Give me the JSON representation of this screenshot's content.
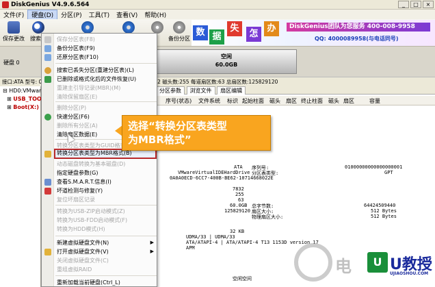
{
  "window": {
    "title": "DiskGenius V4.9.6.564",
    "buttons": [
      "_",
      "□",
      "×"
    ]
  },
  "menubar": [
    "文件(F)",
    "硬盘(D)",
    "分区(P)",
    "工具(T)",
    "查看(V)",
    "帮助(H)"
  ],
  "toolbar": [
    {
      "label": "保存更改",
      "icon": "save-icon"
    },
    {
      "label": "搜索分",
      "icon": "search-icon"
    },
    {
      "label": "",
      "icon": "disk-icon"
    },
    {
      "label": "",
      "icon": "disk-icon"
    },
    {
      "label": "",
      "icon": "disk-icon"
    },
    {
      "label": "备份分区",
      "icon": "disk-icon"
    }
  ],
  "banner": {
    "chars": [
      "数",
      "据",
      "失",
      "怎",
      "办"
    ],
    "slogan": "DiskGenius团队为您服务",
    "phone": "400-008-9958",
    "qq": "QQ: 4000089958(与电话同号)"
  },
  "disk": {
    "left_label": "硬盘 0",
    "partition_name": "空闲",
    "partition_size": "60.0GB",
    "info_line": "接口:ATA  型号:  000000001  容量:60.0GB(61440MB)  柱面数:7832  磁头数:255  每道扇区数:63  总扇区数:125829120"
  },
  "tree": [
    {
      "label": "HD0:VMware...",
      "indent": 0
    },
    {
      "label": "USB_TOOL",
      "indent": 1
    },
    {
      "label": "Boot(X:)",
      "indent": 1
    }
  ],
  "tabs": [
    "分区参数",
    "浏览文件",
    "扇区编辑"
  ],
  "columns": [
    "序号(状态)",
    "文件系统",
    "标识",
    "起始柱面",
    "磁头",
    "扇区",
    "终止柱面",
    "磁头",
    "扇区",
    "容量"
  ],
  "details": {
    "interface": "ATA",
    "model": "VMwareVirtualIDEHardDrive",
    "serial": "0A0A0ECD-6CC7-400B-BE62-10714668022E",
    "sn_label": "序列号:",
    "sn_value": "01000000000000000001",
    "pt_label": "分区表类型:",
    "pt_value": "GPT",
    "cylinders": "7832",
    "heads": "255",
    "sectors": "63",
    "capacity": "60.0GB",
    "total_sectors": "125829120",
    "bytes_label": "总字节数:",
    "bytes_value": "64424509440",
    "sector_size_label": "扇区大小:",
    "sector_size_value": "512 Bytes",
    "phys_label": "物理扇区大小:",
    "phys_value": "512 Bytes",
    "buffer": "32 KB",
    "udma": "UDMA/33 | UDMA/33",
    "ata": "ATA/ATAPI-4 | ATA/ATAPI-4 T13 1153D version 17",
    "apm": "APM",
    "free_space": "空闲空间"
  },
  "menu": {
    "items": [
      {
        "label": "保存分区表(F8)",
        "disabled": true
      },
      {
        "label": "备份分区表(F9)",
        "disabled": false
      },
      {
        "label": "还原分区表(F10)",
        "disabled": false
      },
      {
        "label": "搜索已丢失分区(重建分区表)(L)",
        "disabled": false
      },
      {
        "label": "已删除或格式化后的文件恢复(U)",
        "disabled": false
      },
      {
        "label": "重建主引导记录(MBR)(M)",
        "disabled": true
      },
      {
        "label": "清除保留扇区(E)",
        "disabled": true
      },
      {
        "label": "删除分区(P)",
        "disabled": true
      },
      {
        "label": "快速分区(F6)",
        "disabled": false
      },
      {
        "label": "删除所有分区(A)",
        "disabled": true
      },
      {
        "label": "清除扇区数据(E)",
        "disabled": false
      },
      {
        "label": "转换分区表类型为GUID格式(P)",
        "disabled": true
      },
      {
        "label": "转换分区表类型为MBR格式(B)",
        "disabled": false,
        "highlight": true
      },
      {
        "label": "动态磁盘转换为基本磁盘(D)",
        "disabled": true
      },
      {
        "label": "指定硬盘参数(G)",
        "disabled": false
      },
      {
        "label": "查看S.M.A.R.T.信息(I)",
        "disabled": false
      },
      {
        "label": "坏道检测与修复(Y)",
        "disabled": false
      },
      {
        "label": "复位坏扇区记录",
        "disabled": true
      },
      {
        "label": "转换为USB-ZIP启动模式(Z)",
        "disabled": true
      },
      {
        "label": "转换为USB-FDD启动模式(F)",
        "disabled": true
      },
      {
        "label": "转换为HDD模式(H)",
        "disabled": true
      },
      {
        "label": "新建虚拟硬盘文件(N)",
        "disabled": false,
        "submenu": true
      },
      {
        "label": "打开虚拟硬盘文件(V)",
        "disabled": false,
        "submenu": true
      },
      {
        "label": "关闭虚拟硬盘文件(C)",
        "disabled": true
      },
      {
        "label": "重组虚拟RAID",
        "disabled": true
      },
      {
        "label": "重新加载当前硬盘(Ctrl_L)",
        "disabled": false
      }
    ]
  },
  "callout": {
    "line1": "选择“转换分区表类型",
    "line2": "为MBR格式”"
  },
  "watermark": {
    "char": "电",
    "logo": "U",
    "brand": "U教授",
    "url": "UJIAOSHOU.COM"
  },
  "colors": {
    "highlight_border": "#b8282a",
    "callout_bg": "#f9a51f",
    "brand_blue": "#1a2a9c",
    "brand_green": "#1a8f3a"
  }
}
